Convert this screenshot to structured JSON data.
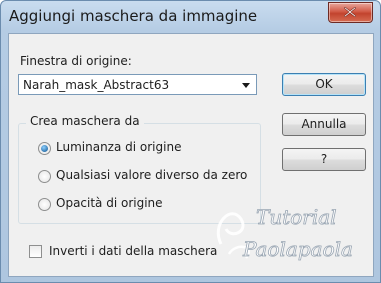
{
  "window": {
    "title": "Aggiungi maschera da immagine"
  },
  "source_window": {
    "label": "Finestra di origine:",
    "selected": "Narah_mask_Abstract63"
  },
  "mask_group": {
    "title": "Crea maschera da",
    "options": [
      {
        "label": "Luminanza di origine",
        "checked": true
      },
      {
        "label": "Qualsiasi valore diverso da zero",
        "checked": false
      },
      {
        "label": "Opacità di origine",
        "checked": false
      }
    ]
  },
  "invert": {
    "label": "Inverti i dati della maschera",
    "checked": false
  },
  "buttons": {
    "ok": "OK",
    "cancel": "Annulla",
    "help": "?"
  },
  "watermark": {
    "line1": "Tutorial",
    "line2": "Paolapaola"
  }
}
